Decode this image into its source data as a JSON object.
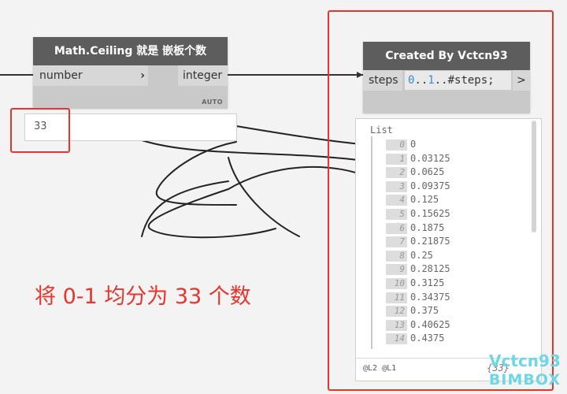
{
  "ceiling_node": {
    "title": "Math.Ceiling 就是 嵌板个数",
    "input_port": "number",
    "output_port": "integer",
    "lacing": "AUTO",
    "input_value": "33"
  },
  "code_block_node": {
    "title": "Created By Vctcn93",
    "input_port": "steps",
    "code_num_0": "0",
    "code_op_1": "..",
    "code_num_1": "1",
    "code_rest": "..#steps;",
    "output_arrow": ">"
  },
  "preview": {
    "title": "List",
    "items": [
      {
        "index": "0",
        "value": "0"
      },
      {
        "index": "1",
        "value": "0.03125"
      },
      {
        "index": "2",
        "value": "0.0625"
      },
      {
        "index": "3",
        "value": "0.09375"
      },
      {
        "index": "4",
        "value": "0.125"
      },
      {
        "index": "5",
        "value": "0.15625"
      },
      {
        "index": "6",
        "value": "0.1875"
      },
      {
        "index": "7",
        "value": "0.21875"
      },
      {
        "index": "8",
        "value": "0.25"
      },
      {
        "index": "9",
        "value": "0.28125"
      },
      {
        "index": "10",
        "value": "0.3125"
      },
      {
        "index": "11",
        "value": "0.34375"
      },
      {
        "index": "12",
        "value": "0.375"
      },
      {
        "index": "13",
        "value": "0.40625"
      },
      {
        "index": "14",
        "value": "0.4375"
      }
    ],
    "levels": "@L2 @L1",
    "count": "{33}"
  },
  "annotation": "将 0-1 均分为 33 个数",
  "watermark": {
    "line1": "Vctcn93",
    "line2": "BIMBOX"
  },
  "colors": {
    "annotation_red": "#e8342b",
    "node_header": "#5d5d5d",
    "code_number": "#3c8ad8",
    "watermark": "#6fd6e6"
  }
}
